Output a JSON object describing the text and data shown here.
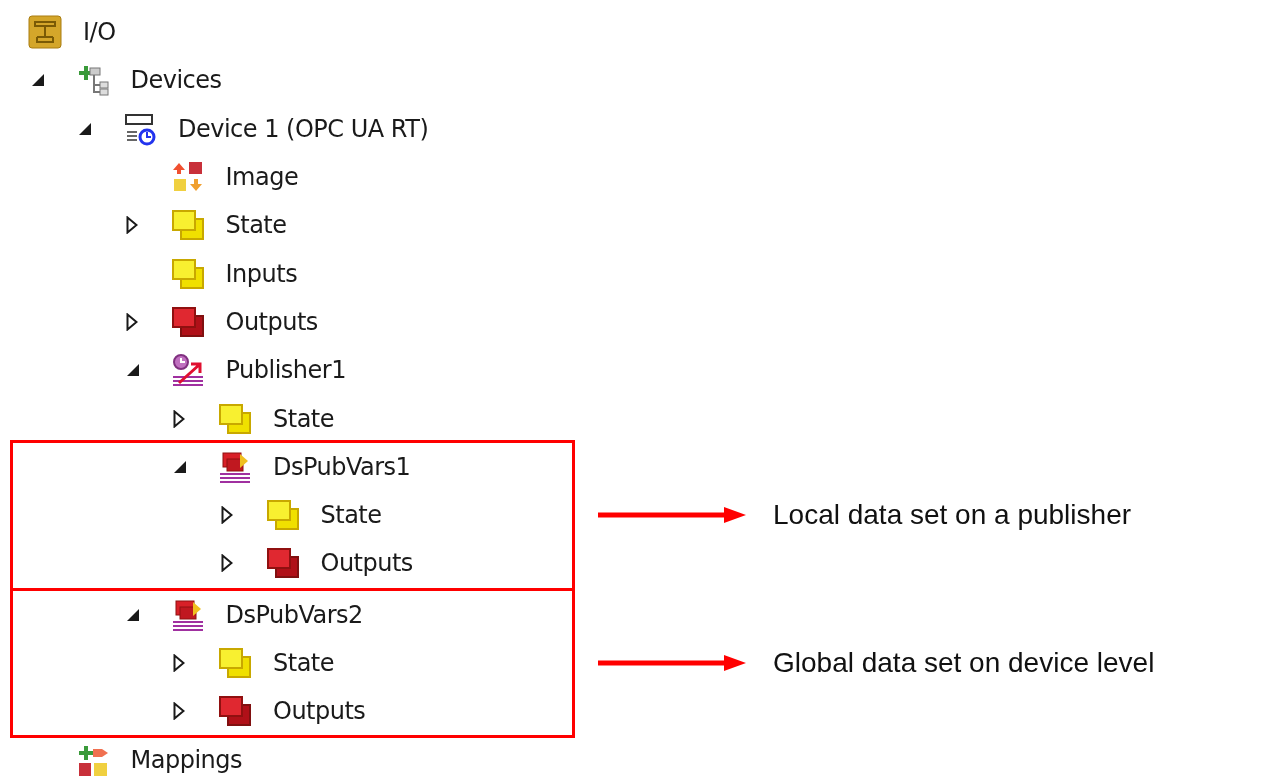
{
  "tree": [
    {
      "label": "I/O",
      "kind": "io",
      "children": [
        {
          "label": "Devices",
          "kind": "devices",
          "expanded": true,
          "children": [
            {
              "label": "Device 1 (OPC UA RT)",
              "kind": "opc",
              "expanded": true,
              "children": [
                {
                  "label": "Image",
                  "kind": "image"
                },
                {
                  "label": "State",
                  "kind": "state",
                  "expanded": false
                },
                {
                  "label": "Inputs",
                  "kind": "inputs"
                },
                {
                  "label": "Outputs",
                  "kind": "outputs",
                  "expanded": false
                },
                {
                  "label": "Publisher1",
                  "kind": "publisher",
                  "expanded": true,
                  "children": [
                    {
                      "label": "State",
                      "kind": "state",
                      "expanded": false
                    },
                    {
                      "label": "DsPubVars1",
                      "kind": "dataset",
                      "expanded": true,
                      "callout": "Local data set on a publisher",
                      "children": [
                        {
                          "label": "State",
                          "kind": "state",
                          "expanded": false
                        },
                        {
                          "label": "Outputs",
                          "kind": "outputs",
                          "expanded": false
                        }
                      ]
                    }
                  ]
                },
                {
                  "label": "DsPubVars2",
                  "kind": "dataset",
                  "expanded": true,
                  "callout": "Global data set on device level",
                  "children": [
                    {
                      "label": "State",
                      "kind": "state",
                      "expanded": false
                    },
                    {
                      "label": "Outputs",
                      "kind": "outputs",
                      "expanded": false
                    }
                  ]
                }
              ]
            }
          ]
        },
        {
          "label": "Mappings",
          "kind": "mappings"
        }
      ]
    }
  ]
}
